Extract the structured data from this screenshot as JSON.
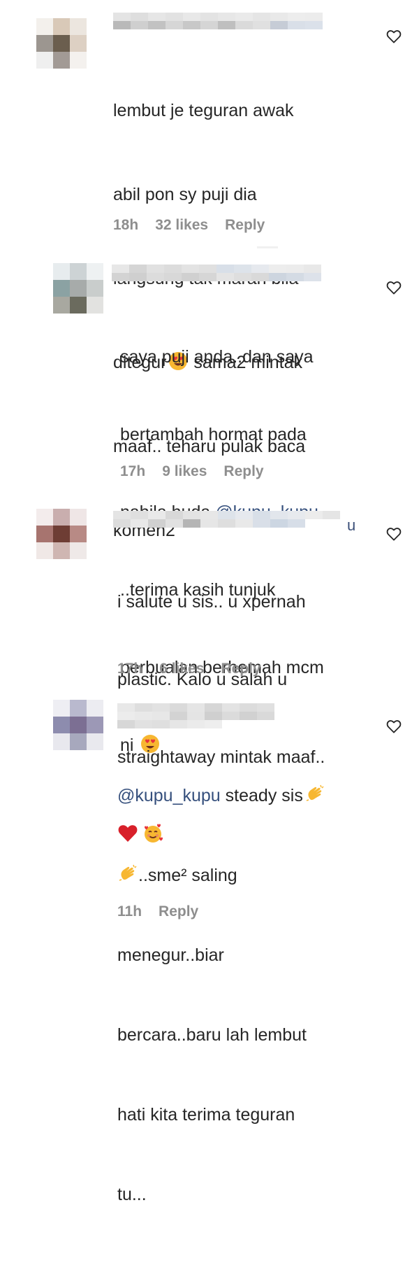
{
  "comments": [
    {
      "lines": [
        "lembut je teguran awak",
        "abil pon sy puji dia",
        "langsung tak marah bila",
        "ditegur",
        "maaf.. teharu pulak baca",
        "komen2"
      ],
      "line4_after_emoji": " sama2 mintak",
      "time": "18h",
      "likes": "32 likes",
      "reply": "Reply",
      "emoji_1": "heart-eyes",
      "avatar_colors": [
        "#f3f0ec",
        "#d9c9b8",
        "#ece6df",
        "#9c9690",
        "#6b5e4e",
        "#ddd0c3",
        "#efefef",
        "#a29a95",
        "#f4f1ee"
      ],
      "username_colors": [
        "#e4e4e4",
        "#dedede",
        "#e6e6e6",
        "#e2e2e2",
        "#e8e8e8",
        "#e3e3e3",
        "#e7e7e7",
        "#eaeaea",
        "#e5e5e5",
        "#e9e9e9",
        "#ededed",
        "#ececec",
        "#b9b9b9",
        "#cfcfcf",
        "#c2c2c2",
        "#d6d6d6",
        "#c8c8c8",
        "#d5d5d5",
        "#bfbfbf",
        "#dadada",
        "#e0e0e0",
        "#c6ccd6",
        "#d9dfe8",
        "#dbe1ea"
      ]
    },
    {
      "lines": [
        "saya puji anda..dan saya",
        "bertambah hormat pada",
        "nabila huda ",
        "..terima kasih tunjuk",
        "perbualan berhemah mcm",
        "ni "
      ],
      "mention": "@kupu_kupu",
      "time": "17h",
      "likes": "9 likes",
      "reply": "Reply",
      "emoji_1": "heart-eyes",
      "avatar_colors": [
        "#e7ecee",
        "#cdd3d5",
        "#eef1f2",
        "#8ba2a3",
        "#a7abaa",
        "#c9cdcc",
        "#a8a8a0",
        "#6b6b5e",
        "#e2e2e0"
      ],
      "username_colors": [
        "#e7e7e7",
        "#d5d5d5",
        "#e1e1e1",
        "#dcdcdc",
        "#e3e3e3",
        "#e0e0e0",
        "#d8dfe8",
        "#dde3ea",
        "#e6e9ee",
        "#ededed",
        "#ececec",
        "#e8e8e8",
        "#d3d3d3",
        "#cfcfcf",
        "#dcdcdc",
        "#d8d8d8",
        "#d0d0d0",
        "#d6d6d6",
        "#e4e4e4",
        "#dedede",
        "#d9d9d9",
        "#cdd5df",
        "#d4dbe4",
        "#dde2ea"
      ]
    },
    {
      "lines": [
        "i salute u sis.. u xpernah",
        "plastic. Kalo u salah u",
        "straightaway mintak maaf..",
        ""
      ],
      "username_tail": "u",
      "time": "17h",
      "likes": "6 likes",
      "reply": "Reply",
      "emoji_1": "red-heart",
      "emoji_2": "smiling-face-with-hearts",
      "avatar_colors": [
        "#f3ecec",
        "#c9aeae",
        "#efe6e6",
        "#a7746f",
        "#6e3d34",
        "#b88a85",
        "#f0e8e6",
        "#cfb6b2",
        "#efe9e8"
      ],
      "username_colors": [
        "#e4e4e4",
        "#dfdfdf",
        "#e9e9e9",
        "#d8d8d8",
        "#e3e3e3",
        "#e7e7e7",
        "#dde3ea",
        "#e6e9ee",
        "#d8dfe8",
        "#e2e6ec",
        "#e7eaee",
        "#ececec",
        "#e5e5e5",
        "#dcdcdc",
        "#e8e8e8",
        "#d0d0d0",
        "#e1e1e1",
        "#b5b5b5",
        "#e6e6e6",
        "#dedede",
        "#e9e9e9",
        "#d9dfe8",
        "#ccd6e2",
        "#d7dee8"
      ]
    },
    {
      "lines": [
        "",
        "..sme² saling",
        "menegur..biar",
        "bercara..baru lah lembut",
        "hati kita terima teguran",
        "tu..."
      ],
      "mention": "@kupu_kupu",
      "line1_after_mention": " steady sis",
      "time": "11h",
      "reply": "Reply",
      "emoji_1": "clapping-hands",
      "avatar_colors": [
        "#eeeef3",
        "#b9b9ce",
        "#ececf1",
        "#8d8cae",
        "#7c6f93",
        "#9c98b6",
        "#e8e8ee",
        "#a7a8bd",
        "#e9e9ee"
      ],
      "username_colors": [
        "#e8e8e8",
        "#dedede",
        "#e2e2e2",
        "#dadada",
        "#e5e5e5",
        "#d6d6d6",
        "#e3e3e3",
        "#dcdcdc",
        "#e0e0e0",
        "#ececec",
        "#e9e9e9",
        "#e7e7e7",
        "#d3d3d3",
        "#e4e4e4",
        "#cfcfcf",
        "#dbdbdb",
        "#d1d1d1",
        "#d9d9d9",
        "#d7d7d7",
        "#e1e1e1",
        "#dfdfdf",
        "#e6e6e6",
        "#ebebeb",
        "#eeeeee"
      ]
    }
  ]
}
